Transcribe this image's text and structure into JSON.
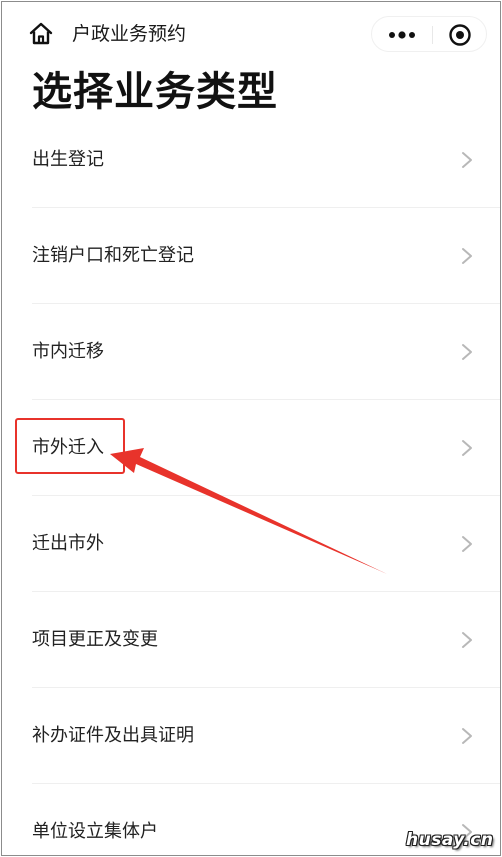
{
  "nav": {
    "title": "户政业务预约",
    "home_icon": "home-icon",
    "more_icon": "more-dots-icon",
    "close_icon": "target-circle-icon"
  },
  "page": {
    "heading": "选择业务类型"
  },
  "list": {
    "items": [
      {
        "label": "出生登记"
      },
      {
        "label": "注销户口和死亡登记"
      },
      {
        "label": "市内迁移"
      },
      {
        "label": "市外迁入",
        "highlighted": true
      },
      {
        "label": "迁出市外"
      },
      {
        "label": "项目更正及变更"
      },
      {
        "label": "补办证件及出具证明"
      },
      {
        "label": "单位设立集体户"
      }
    ],
    "chevron_icon": "chevron-right-icon"
  },
  "annotation": {
    "color": "#e8332b",
    "target_item": "市外迁入"
  },
  "watermark": {
    "text": "husay.cn"
  }
}
